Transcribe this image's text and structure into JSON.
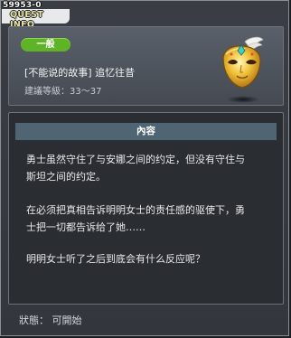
{
  "window": {
    "quest_id": "59953-0",
    "title": "QUEST INFO"
  },
  "quest": {
    "category": "一般",
    "name": "[不能说的故事] 追忆往昔",
    "level_range": "建議等級：33～37",
    "icon": "golden-masquerade-mask-icon"
  },
  "description": {
    "header": "內容",
    "paragraphs": [
      {
        "line1": "勇士虽然守住了与安娜之间的约定，但没有守住与",
        "line2": "斯坦之间的约定。"
      },
      {
        "line1": "在必须把真相告诉明明女士的责任感的驱使下，勇",
        "line2": "士把一切都告诉给了她……"
      },
      {
        "line1": "明明女士听了之后到底会有什么反应呢？",
        "line2": ""
      }
    ]
  },
  "status": {
    "text": "狀態： 可開始"
  },
  "colors": {
    "category_badge": "#5fb327",
    "section_header": "#4f6574",
    "panel_bg": "#2a2d32"
  }
}
